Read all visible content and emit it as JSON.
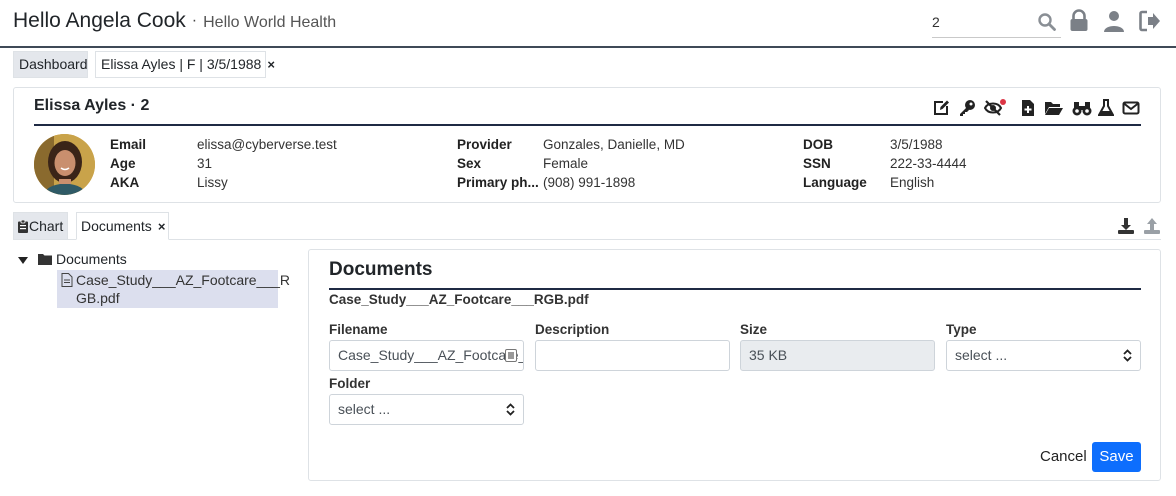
{
  "header": {
    "greeting": "Hello Angela Cook",
    "separator": "·",
    "organization": "Hello World Health",
    "search_value": "2"
  },
  "top_tabs": [
    {
      "label": "Dashboard"
    },
    {
      "label": "Elissa Ayles | F | 3/5/1988",
      "close": "×"
    }
  ],
  "patient": {
    "name": "Elissa Ayles",
    "separator": "·",
    "number": "2",
    "fields": {
      "email": {
        "label": "Email",
        "value": "elissa@cyberverse.test"
      },
      "age": {
        "label": "Age",
        "value": "31"
      },
      "aka": {
        "label": "AKA",
        "value": "Lissy"
      },
      "provider": {
        "label": "Provider",
        "value": "Gonzales, Danielle, MD"
      },
      "sex": {
        "label": "Sex",
        "value": "Female"
      },
      "phone": {
        "label": "Primary ph...",
        "value": "(908) 991-1898"
      },
      "dob": {
        "label": "DOB",
        "value": "3/5/1988"
      },
      "ssn": {
        "label": "SSN",
        "value": "222-33-4444"
      },
      "language": {
        "label": "Language",
        "value": "English"
      }
    }
  },
  "sub_tabs": [
    {
      "label": "Chart"
    },
    {
      "label": "Documents",
      "close": "×"
    }
  ],
  "tree": {
    "root": "Documents",
    "file_line1": "Case_Study___AZ_Footcare___R",
    "file_line2": "GB.pdf"
  },
  "panel": {
    "title": "Documents",
    "subtitle": "Case_Study___AZ_Footcare___RGB.pdf",
    "filename_label": "Filename",
    "filename_value": "Case_Study___AZ_Footcare___RGB.pdf",
    "description_label": "Description",
    "description_value": "",
    "size_label": "Size",
    "size_value": "35 KB",
    "type_label": "Type",
    "type_value": "select ...",
    "folder_label": "Folder",
    "folder_value": "select ...",
    "cancel_label": "Cancel",
    "save_label": "Save"
  },
  "colors": {
    "accent": "#0d6efd",
    "rule": "#1f2a44",
    "alert_dot": "#dc3545",
    "selected_row": "#dcdfee"
  }
}
